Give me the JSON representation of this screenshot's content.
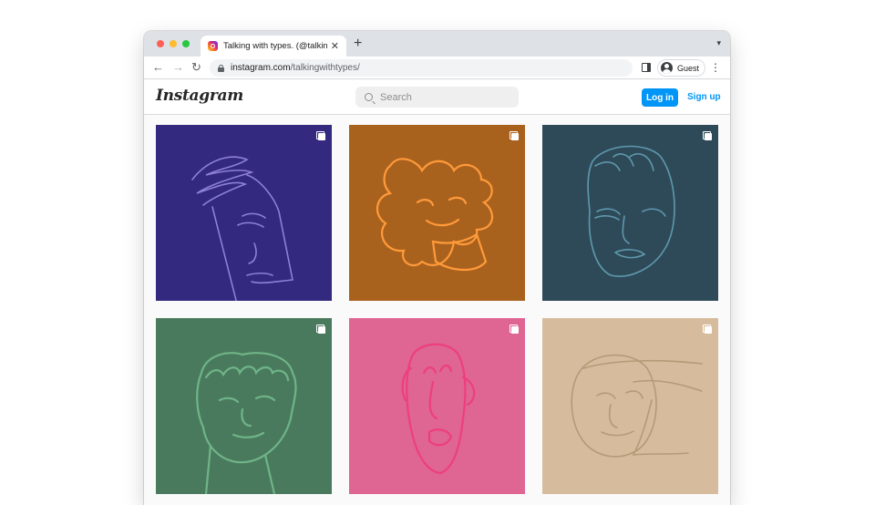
{
  "browser": {
    "tab": {
      "title": "Talking with types. (@talkingwi",
      "favicon": "instagram-favicon"
    },
    "address": {
      "host": "instagram.com",
      "path": "/talkingwithtypes/"
    },
    "profile": {
      "label": "Guest"
    }
  },
  "instagram": {
    "logo": "Instagram",
    "search": {
      "placeholder": "Search"
    },
    "login_label": "Log in",
    "signup_label": "Sign up",
    "colors": {
      "accent": "#0095f6"
    }
  },
  "posts": [
    {
      "bg": "#33297f",
      "line": "#8c80d8",
      "icon": "multi-image-icon"
    },
    {
      "bg": "#a9621e",
      "line": "#ff9a3a",
      "icon": "multi-image-icon"
    },
    {
      "bg": "#2e4a58",
      "line": "#5f98ad",
      "icon": "multi-image-icon"
    },
    {
      "bg": "#4a7a5d",
      "line": "#6fb488",
      "icon": "multi-image-icon"
    },
    {
      "bg": "#df6592",
      "line": "#ed3f7d",
      "icon": "multi-image-icon"
    },
    {
      "bg": "#d6bc9c",
      "line": "#b59a78",
      "icon": "multi-image-icon"
    }
  ]
}
